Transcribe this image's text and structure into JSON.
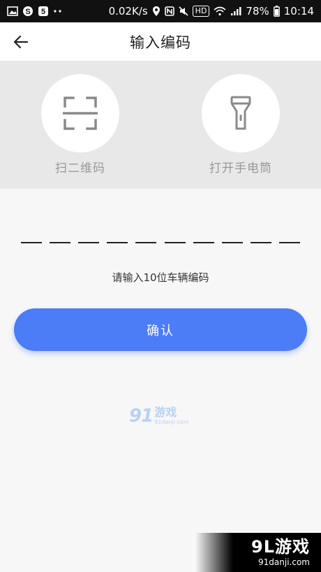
{
  "status_bar": {
    "network_speed": "0.02K/s",
    "hd_label": "HD",
    "battery_percent": "78%",
    "time": "10:14"
  },
  "header": {
    "title": "输入编码",
    "back_icon": "arrow-left-icon"
  },
  "actions": [
    {
      "label": "扫二维码",
      "icon": "scan-frame-icon"
    },
    {
      "label": "打开手电筒",
      "icon": "flashlight-icon"
    }
  ],
  "code_input": {
    "slots": 10,
    "value": ""
  },
  "hint": "请输入10位车辆编码",
  "confirm_button": {
    "label": "确认",
    "color": "#4c7cf6"
  },
  "watermark_center": {
    "brand": "91",
    "name": "游戏",
    "url": "91danji.com"
  },
  "watermark_corner": {
    "brand": "9L游戏",
    "url": "91danji.com"
  }
}
